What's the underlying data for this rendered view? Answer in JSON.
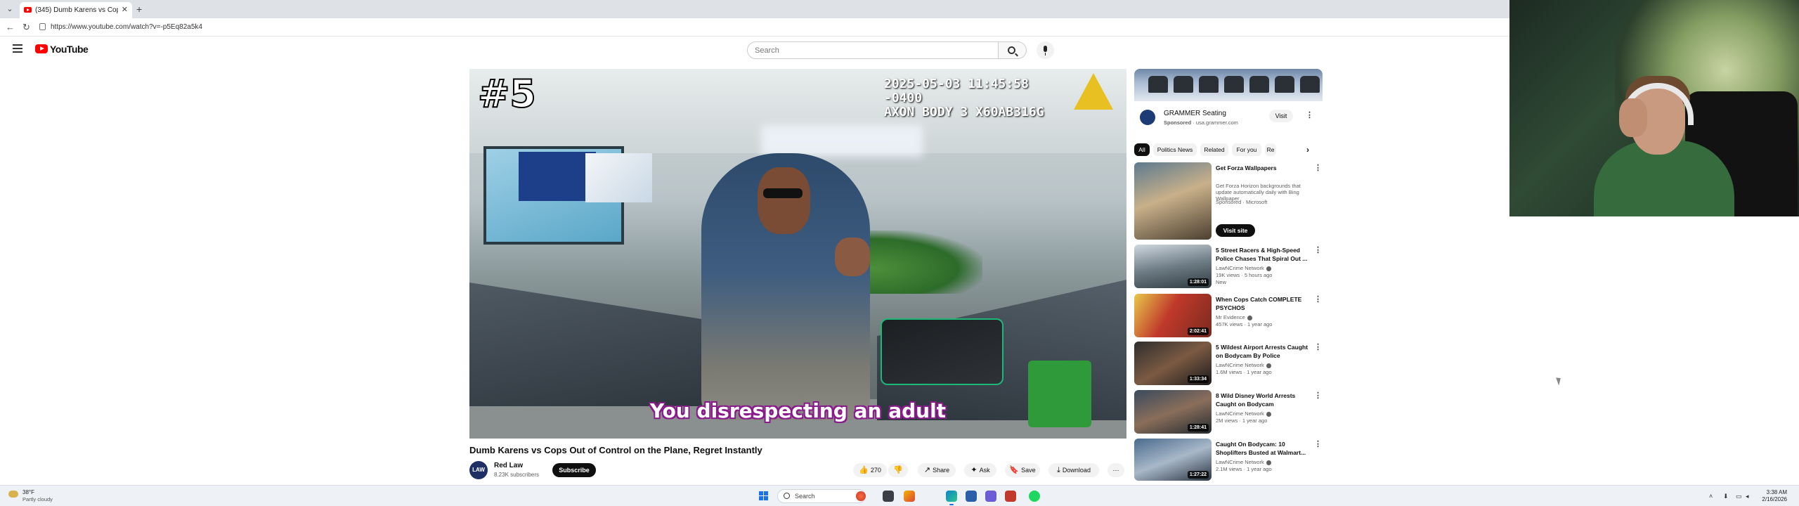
{
  "browser": {
    "tab_title": "(345) Dumb Karens vs Cops O...",
    "new_tab_symbol": "+",
    "close_symbol": "✕",
    "url": "https://www.youtube.com/watch?v=-p5Eq82a5k4"
  },
  "header": {
    "logo_text": "YouTube",
    "search_placeholder": "Search"
  },
  "player": {
    "rank_overlay": "#5",
    "timestamp_line1": "2025-05-03 11:45:58 -0400",
    "timestamp_line2": "AXON BODY 3 X60AB316G",
    "subtitle": "You disrespecting an adult"
  },
  "video": {
    "title": "Dumb Karens vs Cops Out of Control on the Plane, Regret Instantly",
    "channel_name": "Red Law",
    "channel_avatar_text": "LAW",
    "channel_subs": "8.23K subscribers",
    "subscribe_label": "Subscribe",
    "likes": "270",
    "share_label": "Share",
    "ask_label": "Ask",
    "save_label": "Save",
    "download_label": "Download",
    "more_symbol": "⋯"
  },
  "ad": {
    "name": "GRAMMER Seating",
    "sponsored": "Sponsored",
    "domain": "usa.grammer.com",
    "visit_label": "Visit"
  },
  "chips": [
    "All",
    "Related",
    "For you",
    "Re"
  ],
  "chip_politics": "Politics News",
  "recommendations": [
    {
      "title": "Get Forza Wallpapers",
      "channel": "Get Forza Horizon backgrounds that update automatically daily with Bing Wallpaper",
      "meta": "Sponsored · Microsoft",
      "extra": "",
      "duration": "",
      "cta": "Visit site"
    },
    {
      "title": "5 Street Racers & High-Speed Police Chases That Spiral Out ...",
      "channel": "LawNCrime Network",
      "meta": "19K views · 5 hours ago",
      "extra": "New",
      "duration": "1:28:01"
    },
    {
      "title": "When Cops Catch COMPLETE PSYCHOS",
      "channel": "Mr Evidence",
      "meta": "457K views · 1 year ago",
      "extra": "",
      "duration": "2:02:41"
    },
    {
      "title": "5 Wildest Airport Arrests Caught on Bodycam By Police",
      "channel": "LawNCrime Network",
      "meta": "1.6M views · 1 year ago",
      "extra": "",
      "duration": "1:33:34"
    },
    {
      "title": "8 Wild Disney World Arrests Caught on Bodycam",
      "channel": "LawNCrime Network",
      "meta": "2M views · 1 year ago",
      "extra": "",
      "duration": "1:28:41"
    },
    {
      "title": "Caught On Bodycam: 10 Shoplifters Busted at Walmart...",
      "channel": "LawNCrime Network",
      "meta": "2.1M views · 1 year ago",
      "extra": "",
      "duration": "1:27:22"
    }
  ],
  "taskbar": {
    "weather_temp": "38°F",
    "weather_desc": "Partly cloudy",
    "search_label": "Search",
    "clock_time": "3:38 AM",
    "clock_date": "2/16/2026"
  },
  "colors": {
    "youtube_red": "#ff0000",
    "subtitle_outline": "#8a1a8c",
    "axon_yellow": "#e9c021"
  }
}
